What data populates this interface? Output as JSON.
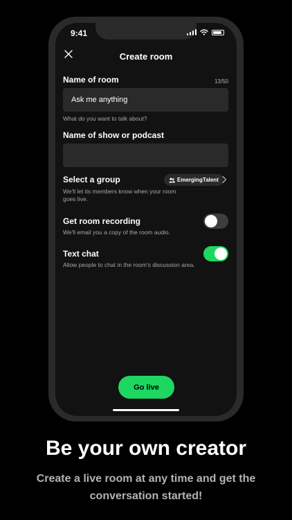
{
  "status_bar": {
    "time": "9:41"
  },
  "header": {
    "title": "Create room"
  },
  "room_name": {
    "label": "Name of room",
    "counter": "13/50",
    "value": "Ask me anything",
    "helper": "What do you want to talk about?"
  },
  "show_name": {
    "label": "Name of show or podcast",
    "value": ""
  },
  "group": {
    "label": "Select a group",
    "helper": "We'll let its members know when your room goes live.",
    "selected": "EmergingTalent"
  },
  "recording": {
    "label": "Get room recording",
    "helper": "We'll email you a copy of the room audio.",
    "enabled": false
  },
  "text_chat": {
    "label": "Text chat",
    "helper": "Allow people to chat in the room's discussion area.",
    "enabled": true
  },
  "go_live_label": "Go live",
  "promo": {
    "headline": "Be your own creator",
    "subline": "Create a live room at any time and get the conversation started!"
  },
  "colors": {
    "accent": "#1ed760",
    "background": "#121212",
    "field": "#2a2a2a"
  }
}
